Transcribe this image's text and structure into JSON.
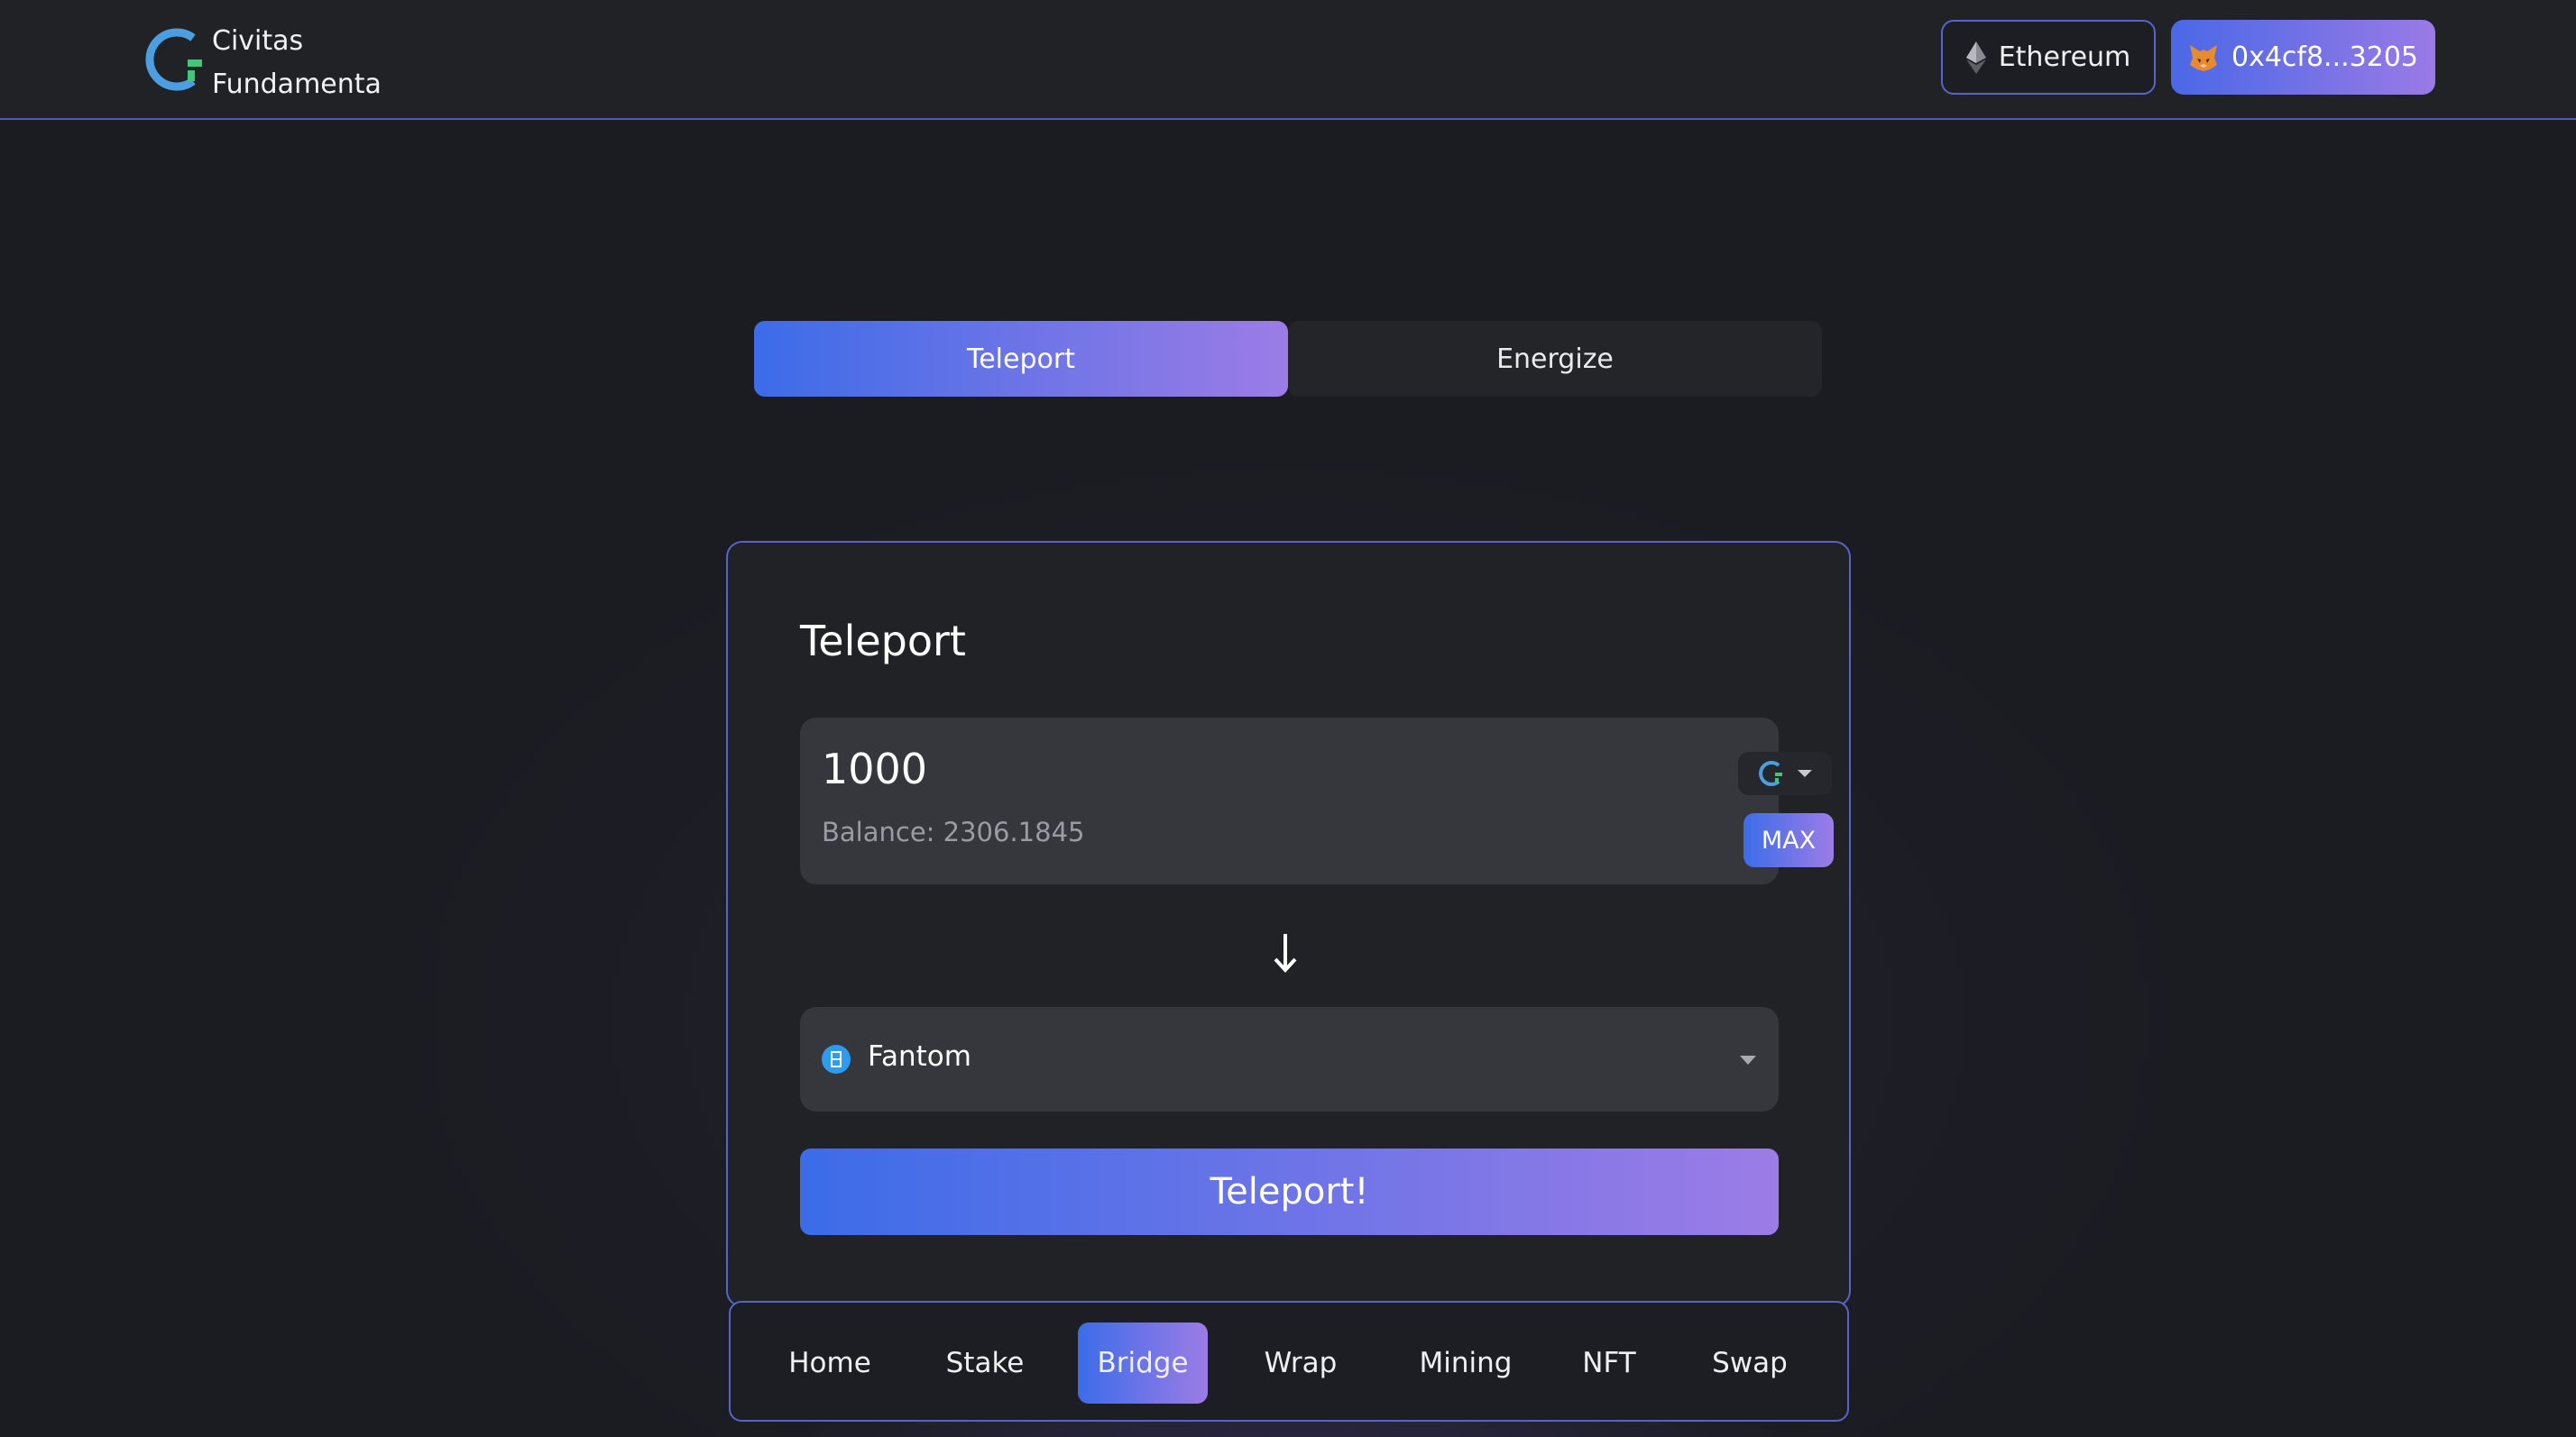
{
  "header": {
    "logo_line1": "Civitas",
    "logo_line2": "Fundamenta",
    "network_label": "Ethereum",
    "network_icon": "ethereum-icon",
    "wallet_label": "0x4cf8...3205",
    "wallet_icon": "metamask-fox-icon"
  },
  "tabs": [
    {
      "label": "Teleport",
      "active": true
    },
    {
      "label": "Energize",
      "active": false
    }
  ],
  "card": {
    "title": "Teleport",
    "amount_value": "1000",
    "balance_text": "Balance: 2306.1845",
    "token_icon": "civitas-token-icon",
    "max_label": "MAX",
    "arrow_icon": "arrow-down-icon",
    "destination_chain": "Fantom",
    "destination_icon": "fantom-icon",
    "submit_label": "Teleport!"
  },
  "nav": [
    {
      "label": "Home",
      "active": false
    },
    {
      "label": "Stake",
      "active": false
    },
    {
      "label": "Bridge",
      "active": true
    },
    {
      "label": "Wrap",
      "active": false
    },
    {
      "label": "Mining",
      "active": false
    },
    {
      "label": "NFT",
      "active": false
    },
    {
      "label": "Swap",
      "active": false
    }
  ],
  "colors": {
    "accent_start": "#3c6ce8",
    "accent_end": "#9c7ce6",
    "background": "#1b1c22",
    "panel": "#212226",
    "input": "#36373d",
    "border": "#5763c8",
    "logo_blue": "#4b9fe0",
    "logo_green": "#3fc77a"
  }
}
